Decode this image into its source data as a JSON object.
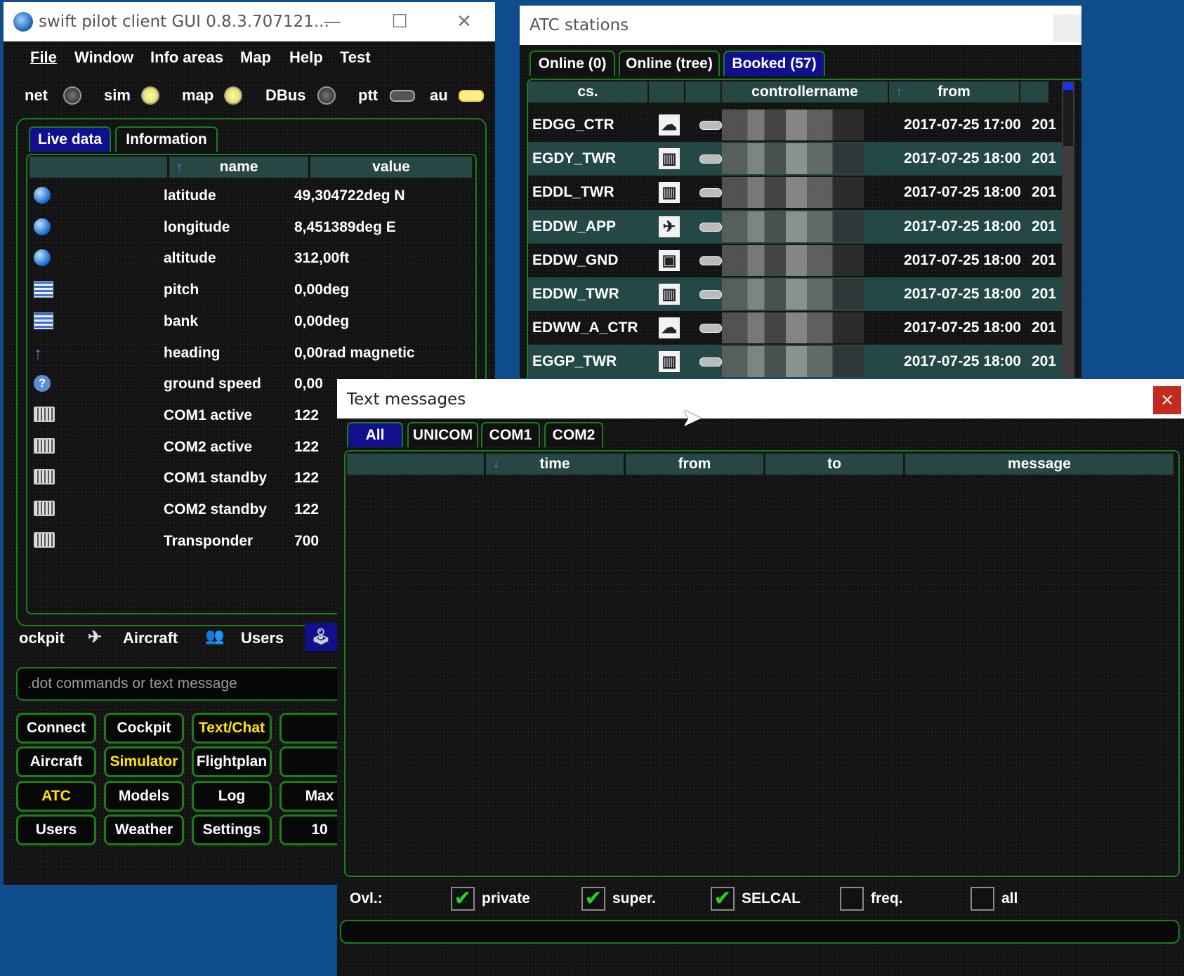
{
  "main": {
    "title": "swift pilot client GUI 0.8.3.707121...",
    "menu": [
      "File",
      "Window",
      "Info areas",
      "Map",
      "Help",
      "Test"
    ],
    "status": {
      "net": "net",
      "sim": "sim",
      "map": "map",
      "dbus": "DBus",
      "ptt": "ptt",
      "au": "au"
    },
    "tabs": [
      "Live data",
      "Information"
    ],
    "table": {
      "headers": {
        "name": "name",
        "value": "value"
      },
      "rows": [
        {
          "icon": "globe-icon",
          "name": "latitude",
          "value": "49,304722deg N"
        },
        {
          "icon": "globe-icon",
          "name": "longitude",
          "value": "8,451389deg E"
        },
        {
          "icon": "globe-icon",
          "name": "altitude",
          "value": "312,00ft"
        },
        {
          "icon": "list-icon",
          "name": "pitch",
          "value": "0,00deg"
        },
        {
          "icon": "list-icon",
          "name": "bank",
          "value": "0,00deg"
        },
        {
          "icon": "arrow-up-icon",
          "name": "heading",
          "value": "0,00rad magnetic"
        },
        {
          "icon": "help-icon",
          "name": "ground speed",
          "value": "0,00"
        },
        {
          "icon": "radio-icon",
          "name": "COM1 active",
          "value": "122"
        },
        {
          "icon": "radio-icon",
          "name": "COM2 active",
          "value": "122"
        },
        {
          "icon": "radio-icon",
          "name": "COM1 standby",
          "value": "122"
        },
        {
          "icon": "radio-icon",
          "name": "COM2 standby",
          "value": "122"
        },
        {
          "icon": "radio-icon",
          "name": "Transponder",
          "value": "700"
        }
      ]
    },
    "nav": {
      "cockpit": "ockpit",
      "aircraft": "Aircraft",
      "users": "Users"
    },
    "command_placeholder": ".dot commands or text message",
    "buttons": [
      {
        "label": "Connect",
        "highlight": false
      },
      {
        "label": "Cockpit",
        "highlight": false
      },
      {
        "label": "Text/Chat",
        "highlight": true
      },
      {
        "label": "",
        "highlight": false
      },
      {
        "label": "Aircraft",
        "highlight": false
      },
      {
        "label": "Simulator",
        "highlight": true
      },
      {
        "label": "Flightplan",
        "highlight": false
      },
      {
        "label": "",
        "highlight": false
      },
      {
        "label": "ATC",
        "highlight": true
      },
      {
        "label": "Models",
        "highlight": false
      },
      {
        "label": "Log",
        "highlight": false
      },
      {
        "label": "Max",
        "highlight": false
      },
      {
        "label": "Users",
        "highlight": false
      },
      {
        "label": "Weather",
        "highlight": false
      },
      {
        "label": "Settings",
        "highlight": false
      },
      {
        "label": "10",
        "highlight": false
      }
    ]
  },
  "atc": {
    "title": "ATC stations",
    "tabs": [
      "Online (0)",
      "Online (tree)",
      "Booked (57)"
    ],
    "headers": {
      "cs": "cs.",
      "controllername": "controllername",
      "from": "from"
    },
    "rows": [
      {
        "cs": "EDGG_CTR",
        "icon": "cloud-icon",
        "from": "2017-07-25 17:00",
        "to": "201"
      },
      {
        "cs": "EGDY_TWR",
        "icon": "tower-icon",
        "from": "2017-07-25 18:00",
        "to": "201"
      },
      {
        "cs": "EDDL_TWR",
        "icon": "tower-icon",
        "from": "2017-07-25 18:00",
        "to": "201"
      },
      {
        "cs": "EDDW_APP",
        "icon": "approach-icon",
        "from": "2017-07-25 18:00",
        "to": "201"
      },
      {
        "cs": "EDDW_GND",
        "icon": "ground-icon",
        "from": "2017-07-25 18:00",
        "to": "201"
      },
      {
        "cs": "EDDW_TWR",
        "icon": "tower-icon",
        "from": "2017-07-25 18:00",
        "to": "201"
      },
      {
        "cs": "EDWW_A_CTR",
        "icon": "cloud-icon",
        "from": "2017-07-25 18:00",
        "to": "201"
      },
      {
        "cs": "EGGP_TWR",
        "icon": "tower-icon",
        "from": "2017-07-25 18:00",
        "to": "201"
      }
    ]
  },
  "text": {
    "title": "Text messages",
    "close": "×",
    "tabs": [
      "All",
      "UNICOM",
      "COM1",
      "COM2"
    ],
    "headers": {
      "time": "time",
      "from": "from",
      "to": "to",
      "message": "message"
    },
    "overlay_label": "Ovl.:",
    "options": [
      {
        "label": "private",
        "checked": true
      },
      {
        "label": "super.",
        "checked": true
      },
      {
        "label": "SELCAL",
        "checked": true
      },
      {
        "label": "freq.",
        "checked": false
      },
      {
        "label": "all",
        "checked": false
      }
    ]
  },
  "colors": {
    "accent_green": "#1b7d1b",
    "selected_tab": "#10108e",
    "highlight_text": "#ffe400",
    "header_bg": "#274744"
  }
}
